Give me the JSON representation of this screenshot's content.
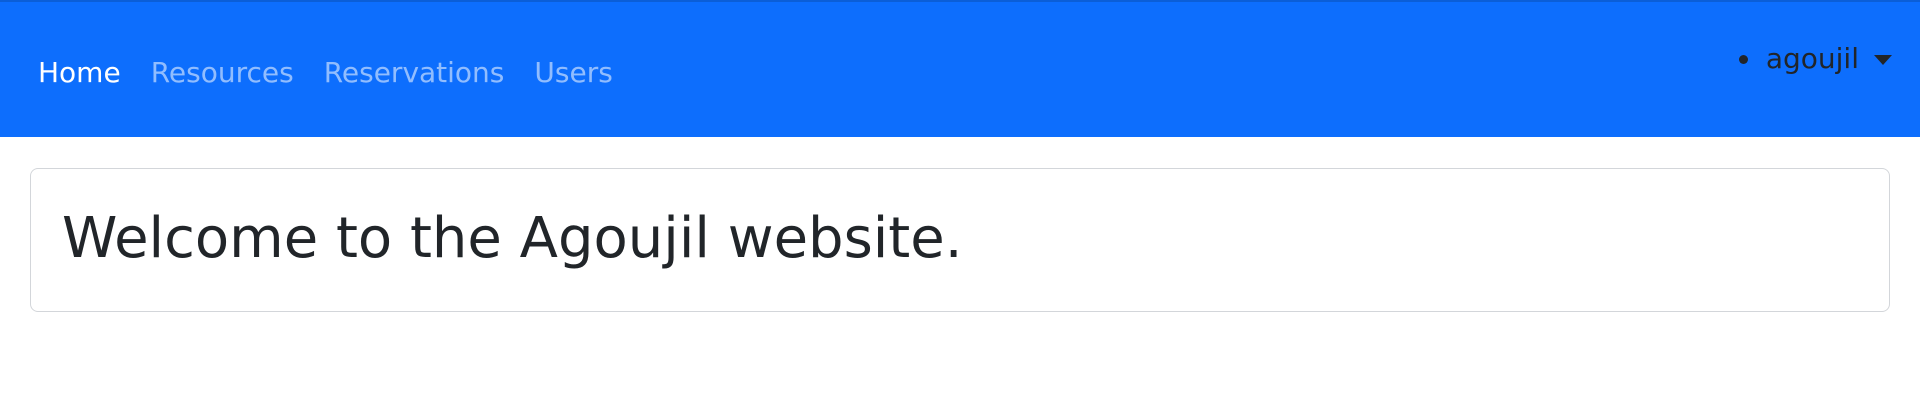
{
  "nav": {
    "items": [
      {
        "label": "Home",
        "active": true
      },
      {
        "label": "Resources",
        "active": false
      },
      {
        "label": "Reservations",
        "active": false
      },
      {
        "label": "Users",
        "active": false
      }
    ]
  },
  "user_menu": {
    "username": "agoujil",
    "icons": [
      "status-dot-icon",
      "caret-down-icon"
    ]
  },
  "main": {
    "welcome_title": "Welcome to the Agoujil website."
  },
  "colors": {
    "navbar": "#0d6efd",
    "active_link": "#ffffff",
    "inactive_link": "#8cb8fe",
    "text": "#212529"
  }
}
